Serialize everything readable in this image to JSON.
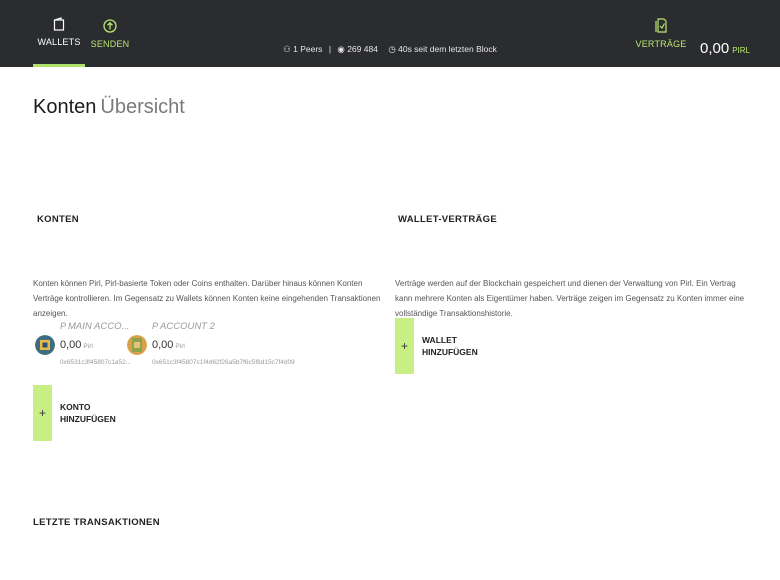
{
  "topbar": {
    "wallets_label": "WALLETS",
    "send_label": "SENDEN",
    "contracts_label": "VERTRÄGE",
    "status": {
      "peers": "1 Peers",
      "block": "269 484",
      "last_block": "40s seit dem letzten Block"
    },
    "balance": {
      "amount": "0,00",
      "unit": "PIRL"
    },
    "colors": {
      "accent": "#b8e86e",
      "bar": "#2b2c30"
    }
  },
  "page": {
    "title_strong": "Konten",
    "title_light": "Übersicht"
  },
  "accounts_section": {
    "title": "KONTEN",
    "description": "Konten können Pirl, Pirl-basierte Token oder Coins enthalten. Darüber hinaus können Konten Verträge kontrollieren. Im Gegensatz zu Wallets können Konten keine eingehenden Transaktionen anzeigen.",
    "accounts": [
      {
        "name": "MAIN ACCO...",
        "balance": "0,00",
        "unit": "Pirl",
        "address": "0x6531c3f45807c1a52..."
      },
      {
        "name": "ACCOUNT 2",
        "balance": "0,00",
        "unit": "Pirl",
        "address": "0x651c3f45807c1f4d62f26a5b7f6c5f8d15c7f4d09"
      }
    ],
    "add_button": {
      "icon": "+",
      "line1": "KONTO",
      "line2": "HINZUFÜGEN"
    }
  },
  "contracts_section": {
    "title": "WALLET-VERTRÄGE",
    "description": "Verträge werden auf der Blockchain gespeichert und dienen der Verwaltung von Pirl. Ein Vertrag kann mehrere Konten als Eigentümer haben. Verträge zeigen im Gegensatz zu Konten immer eine vollständige Transaktionshistorie.",
    "add_button": {
      "icon": "+",
      "line1": "WALLET",
      "line2": "HINZUFÜGEN"
    }
  },
  "transactions_section": {
    "title": "LETZTE TRANSAKTIONEN"
  }
}
